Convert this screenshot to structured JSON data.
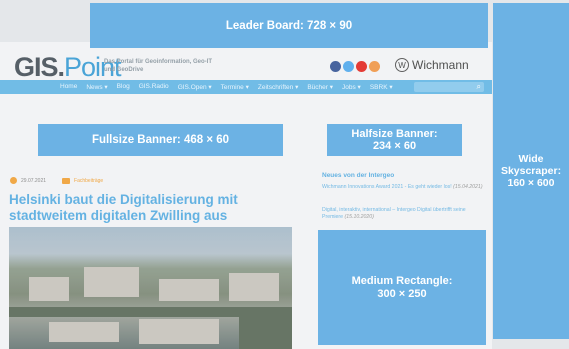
{
  "site": {
    "logo_gis": "GIS.",
    "logo_point": "Point",
    "tagline": "Das Portal für Geoinformation, Geo-IT und GeoDrive",
    "publisher": "Wichmann",
    "nav": [
      "Home",
      "News ▾",
      "Blog",
      "GIS.Radio",
      "GIS.Open ▾",
      "Termine ▾",
      "Zeitschriften ▾",
      "Bücher ▾",
      "Jobs ▾",
      "SBRK ▾"
    ],
    "article": {
      "date": "29.07.2021",
      "category": "Fachbeiträge",
      "title": "Helsinki baut die Digitalisierung mit stadtweitem digitalen Zwilling aus"
    },
    "news": {
      "heading": "Neues von der Intergeo",
      "items": [
        {
          "text": "Wichmann Innovations Award 2021 - Es geht wieder los!",
          "date": "(15.04.2021)"
        },
        {
          "text": "Digital, interaktiv, international – Intergeo Digital übertrifft seine Premiere",
          "date": "(15.10.2020)"
        }
      ]
    }
  },
  "ads": {
    "leaderboard": "Leader Board: 728 × 90",
    "fullsize_banner": "Fullsize Banner: 468 × 60",
    "halfsize_banner_line1": "Halfsize Banner:",
    "halfsize_banner_line2": "234 × 60",
    "wide_skyscraper_line1": "Wide",
    "wide_skyscraper_line2": "Skyscraper:",
    "wide_skyscraper_line3": "160 × 600",
    "medium_rectangle_line1": "Medium Rectangle:",
    "medium_rectangle_line2": "300 × 250"
  },
  "colors": {
    "ad_fill": "#6cb2e4",
    "nav_bar": "#68b9e6",
    "accent_blue": "#5aaee2",
    "accent_orange": "#f2a33a"
  },
  "icons": [
    "facebook-icon",
    "twitter-icon",
    "youtube-icon",
    "rss-icon",
    "wichmann-logo-icon",
    "search-icon",
    "calendar-icon",
    "category-icon"
  ]
}
